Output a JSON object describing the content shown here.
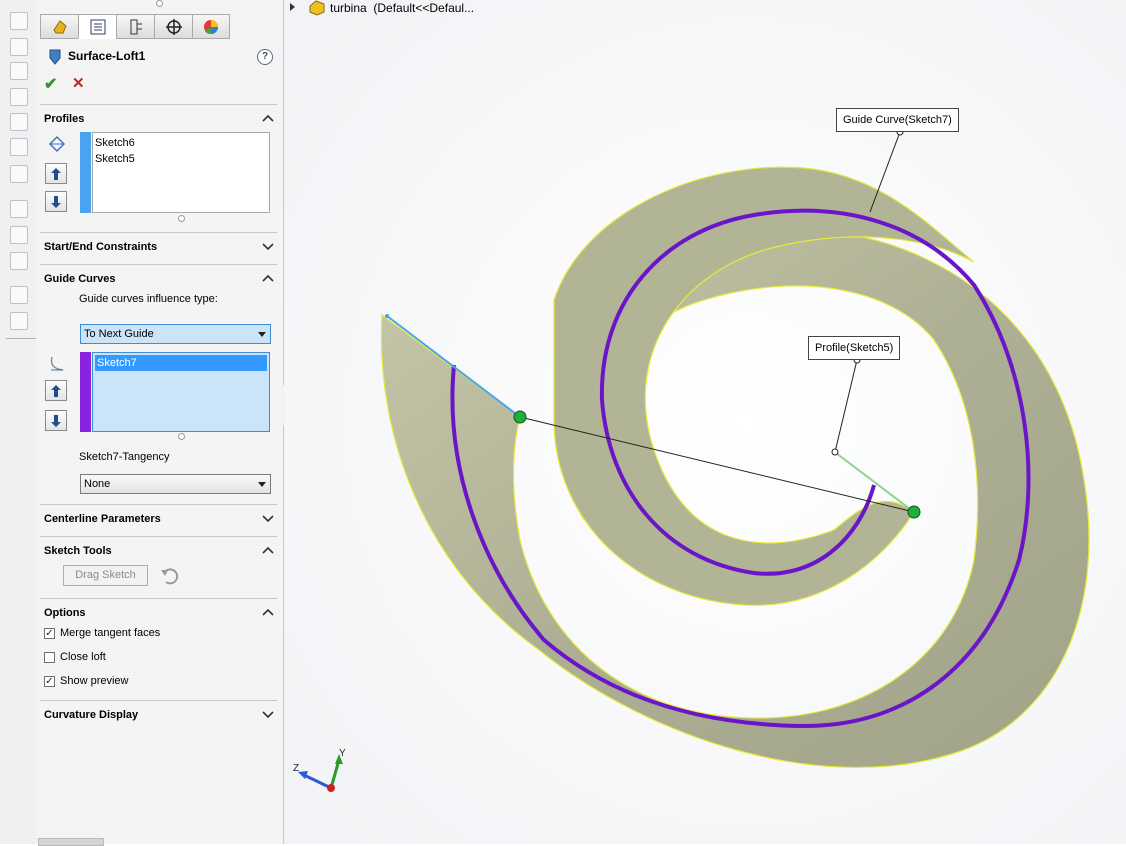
{
  "feature": {
    "title": "Surface-Loft1",
    "help_label": "?",
    "ok_label": "✔",
    "cancel_label": "✕"
  },
  "tabs": [
    {
      "icon": "feature-manager-icon"
    },
    {
      "icon": "property-manager-icon"
    },
    {
      "icon": "configuration-manager-icon"
    },
    {
      "icon": "dimxpert-manager-icon"
    },
    {
      "icon": "display-manager-icon"
    }
  ],
  "profiles": {
    "label": "Profiles",
    "items": [
      "Sketch6",
      "Sketch5"
    ]
  },
  "start_end": {
    "label": "Start/End Constraints"
  },
  "guide_curves": {
    "label": "Guide Curves",
    "influence_label": "Guide curves influence type:",
    "influence_value": "To Next Guide",
    "items": [
      "Sketch7"
    ],
    "tangency_label": "Sketch7-Tangency",
    "tangency_value": "None"
  },
  "centerline": {
    "label": "Centerline Parameters"
  },
  "sketch_tools": {
    "label": "Sketch Tools",
    "drag_label": "Drag Sketch"
  },
  "options": {
    "label": "Options",
    "items": [
      {
        "label": "Merge tangent faces",
        "checked": true
      },
      {
        "label": "Close loft",
        "checked": false
      },
      {
        "label": "Show preview",
        "checked": true
      }
    ]
  },
  "curvature": {
    "label": "Curvature Display"
  },
  "tree": {
    "title": "turbina  (Default<<Defaul..."
  },
  "callouts": {
    "guide": "Guide Curve(Sketch7)",
    "profile": "Profile(Sketch5)"
  },
  "triad": {
    "x": "",
    "y": "Y",
    "z": "Z"
  },
  "colors": {
    "profile_bar": "#4aa3f0",
    "guide_bar": "#8a22e0",
    "guide_curve": "#6a16c8",
    "surface": "#b7b89a",
    "edge": "#e8ea3a",
    "selection": "#cce4f7"
  }
}
